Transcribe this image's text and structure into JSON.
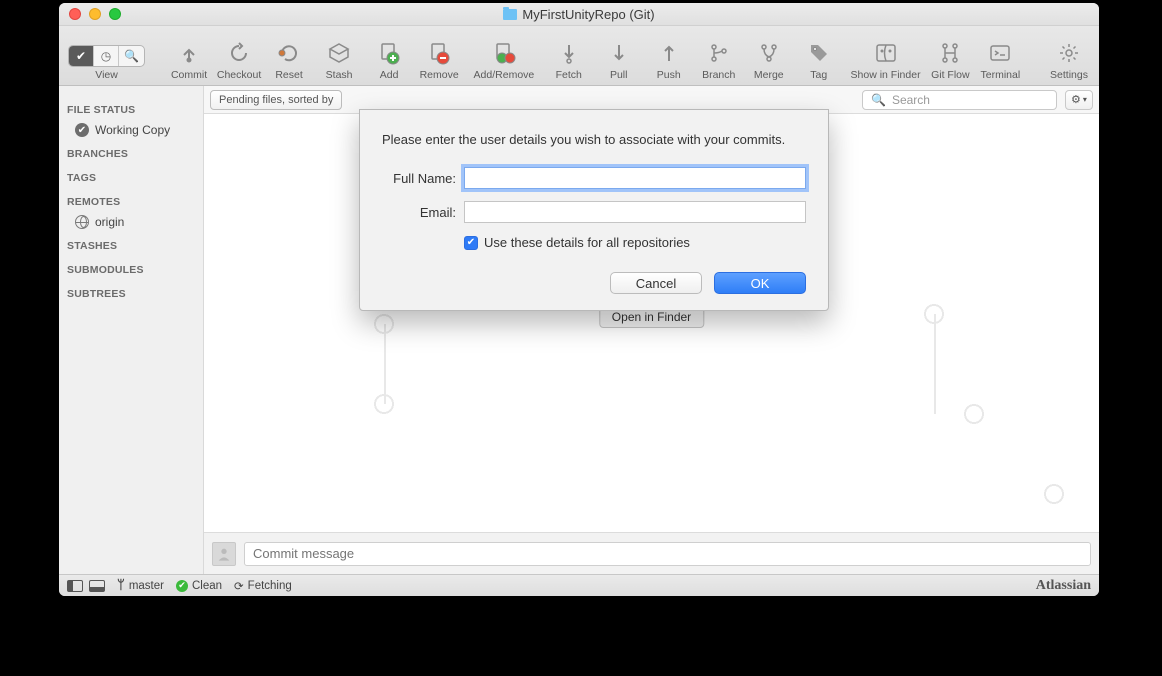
{
  "window": {
    "title": "MyFirstUnityRepo (Git)"
  },
  "toolbar": {
    "view_label": "View",
    "commit": "Commit",
    "checkout": "Checkout",
    "reset": "Reset",
    "stash": "Stash",
    "add": "Add",
    "remove": "Remove",
    "add_remove": "Add/Remove",
    "fetch": "Fetch",
    "pull": "Pull",
    "push": "Push",
    "branch": "Branch",
    "merge": "Merge",
    "tag": "Tag",
    "show_in_finder": "Show in Finder",
    "git_flow": "Git Flow",
    "terminal": "Terminal",
    "settings": "Settings"
  },
  "sidebar": {
    "file_status_head": "FILE STATUS",
    "working_copy": "Working Copy",
    "branches_head": "BRANCHES",
    "tags_head": "TAGS",
    "remotes_head": "REMOTES",
    "origin": "origin",
    "stashes_head": "STASHES",
    "submodules_head": "SUBMODULES",
    "subtrees_head": "SUBTREES"
  },
  "filter": {
    "pending_combo": "Pending files, sorted by",
    "search_placeholder": "Search"
  },
  "content": {
    "open_in_finder": "Open in Finder"
  },
  "commit": {
    "placeholder": "Commit message"
  },
  "status": {
    "branch": "master",
    "clean": "Clean",
    "fetching": "Fetching",
    "brand": "Atlassian"
  },
  "modal": {
    "prompt": "Please enter the user details you wish to associate with your commits.",
    "full_name_label": "Full Name:",
    "full_name_value": "",
    "email_label": "Email:",
    "email_value": "",
    "use_all_label": "Use these details for all repositories",
    "use_all_checked": true,
    "cancel": "Cancel",
    "ok": "OK"
  }
}
